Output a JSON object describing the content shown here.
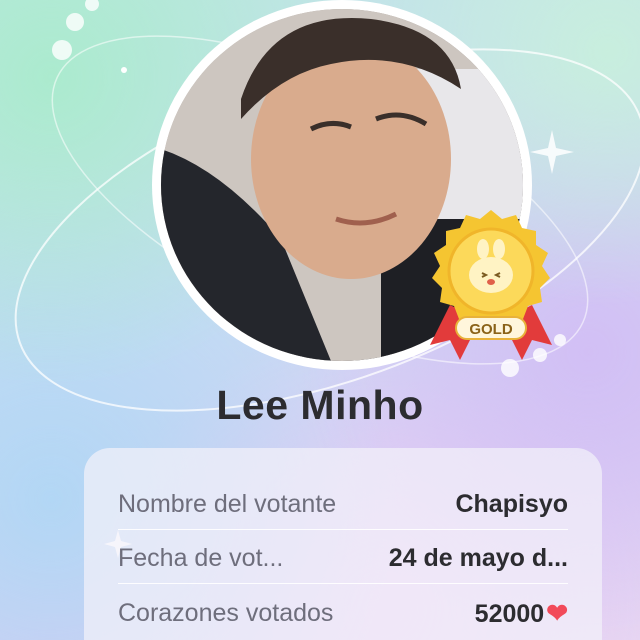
{
  "profile": {
    "name": "Lee Minho",
    "avatar_label": "photo of Lee Minho",
    "badge": {
      "text": "GOLD",
      "icon": "gold-medal-icon"
    }
  },
  "vote_info": {
    "rows": [
      {
        "label": "Nombre del votante",
        "value": "Chapisyo"
      },
      {
        "label": "Fecha de vot...",
        "value": "24 de mayo d..."
      },
      {
        "label": "Corazones votados",
        "value": "52000",
        "icon": "heart-icon"
      }
    ]
  },
  "colors": {
    "heart": "#f24a5a",
    "gold": "#f5c531",
    "ribbon": "#e23b3b",
    "text_dark": "#2c2c30",
    "text_label": "#6e6e7c"
  }
}
